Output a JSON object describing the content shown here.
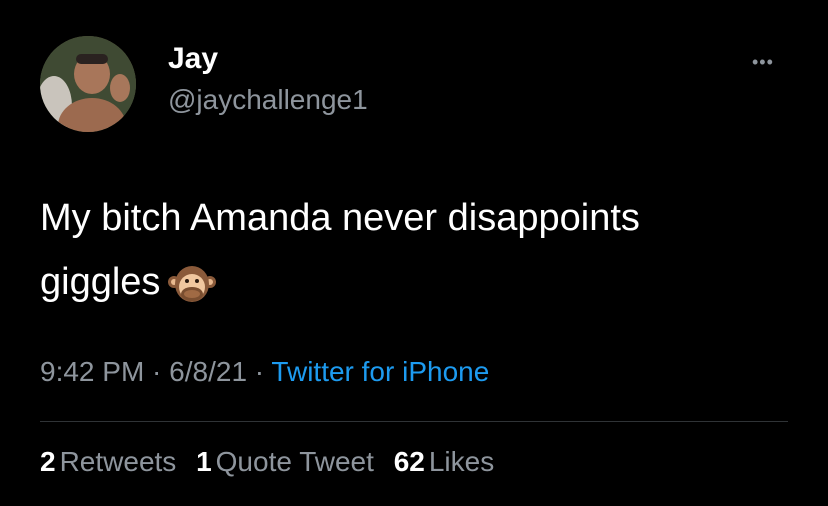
{
  "user": {
    "display_name": "Jay",
    "handle": "@jaychallenge1"
  },
  "menu": {
    "more_icon": "more-horizontal-icon",
    "more_text": "•••"
  },
  "tweet": {
    "line1": "My bitch Amanda never disappoints",
    "line2": "giggles",
    "emoji": "see-no-evil-monkey-covering-mouth"
  },
  "meta": {
    "time": "9:42 PM",
    "sep1": " · ",
    "date": "6/8/21",
    "sep2": " · ",
    "source": "Twitter for iPhone"
  },
  "stats": {
    "retweets_count": "2",
    "retweets_label": "Retweets",
    "quote_count": "1",
    "quote_label": "Quote Tweet",
    "likes_count": "62",
    "likes_label": "Likes"
  },
  "colors": {
    "background": "#000000",
    "text": "#ffffff",
    "secondary": "#8e959d",
    "link": "#1d9bf0",
    "divider": "#2f3336"
  }
}
